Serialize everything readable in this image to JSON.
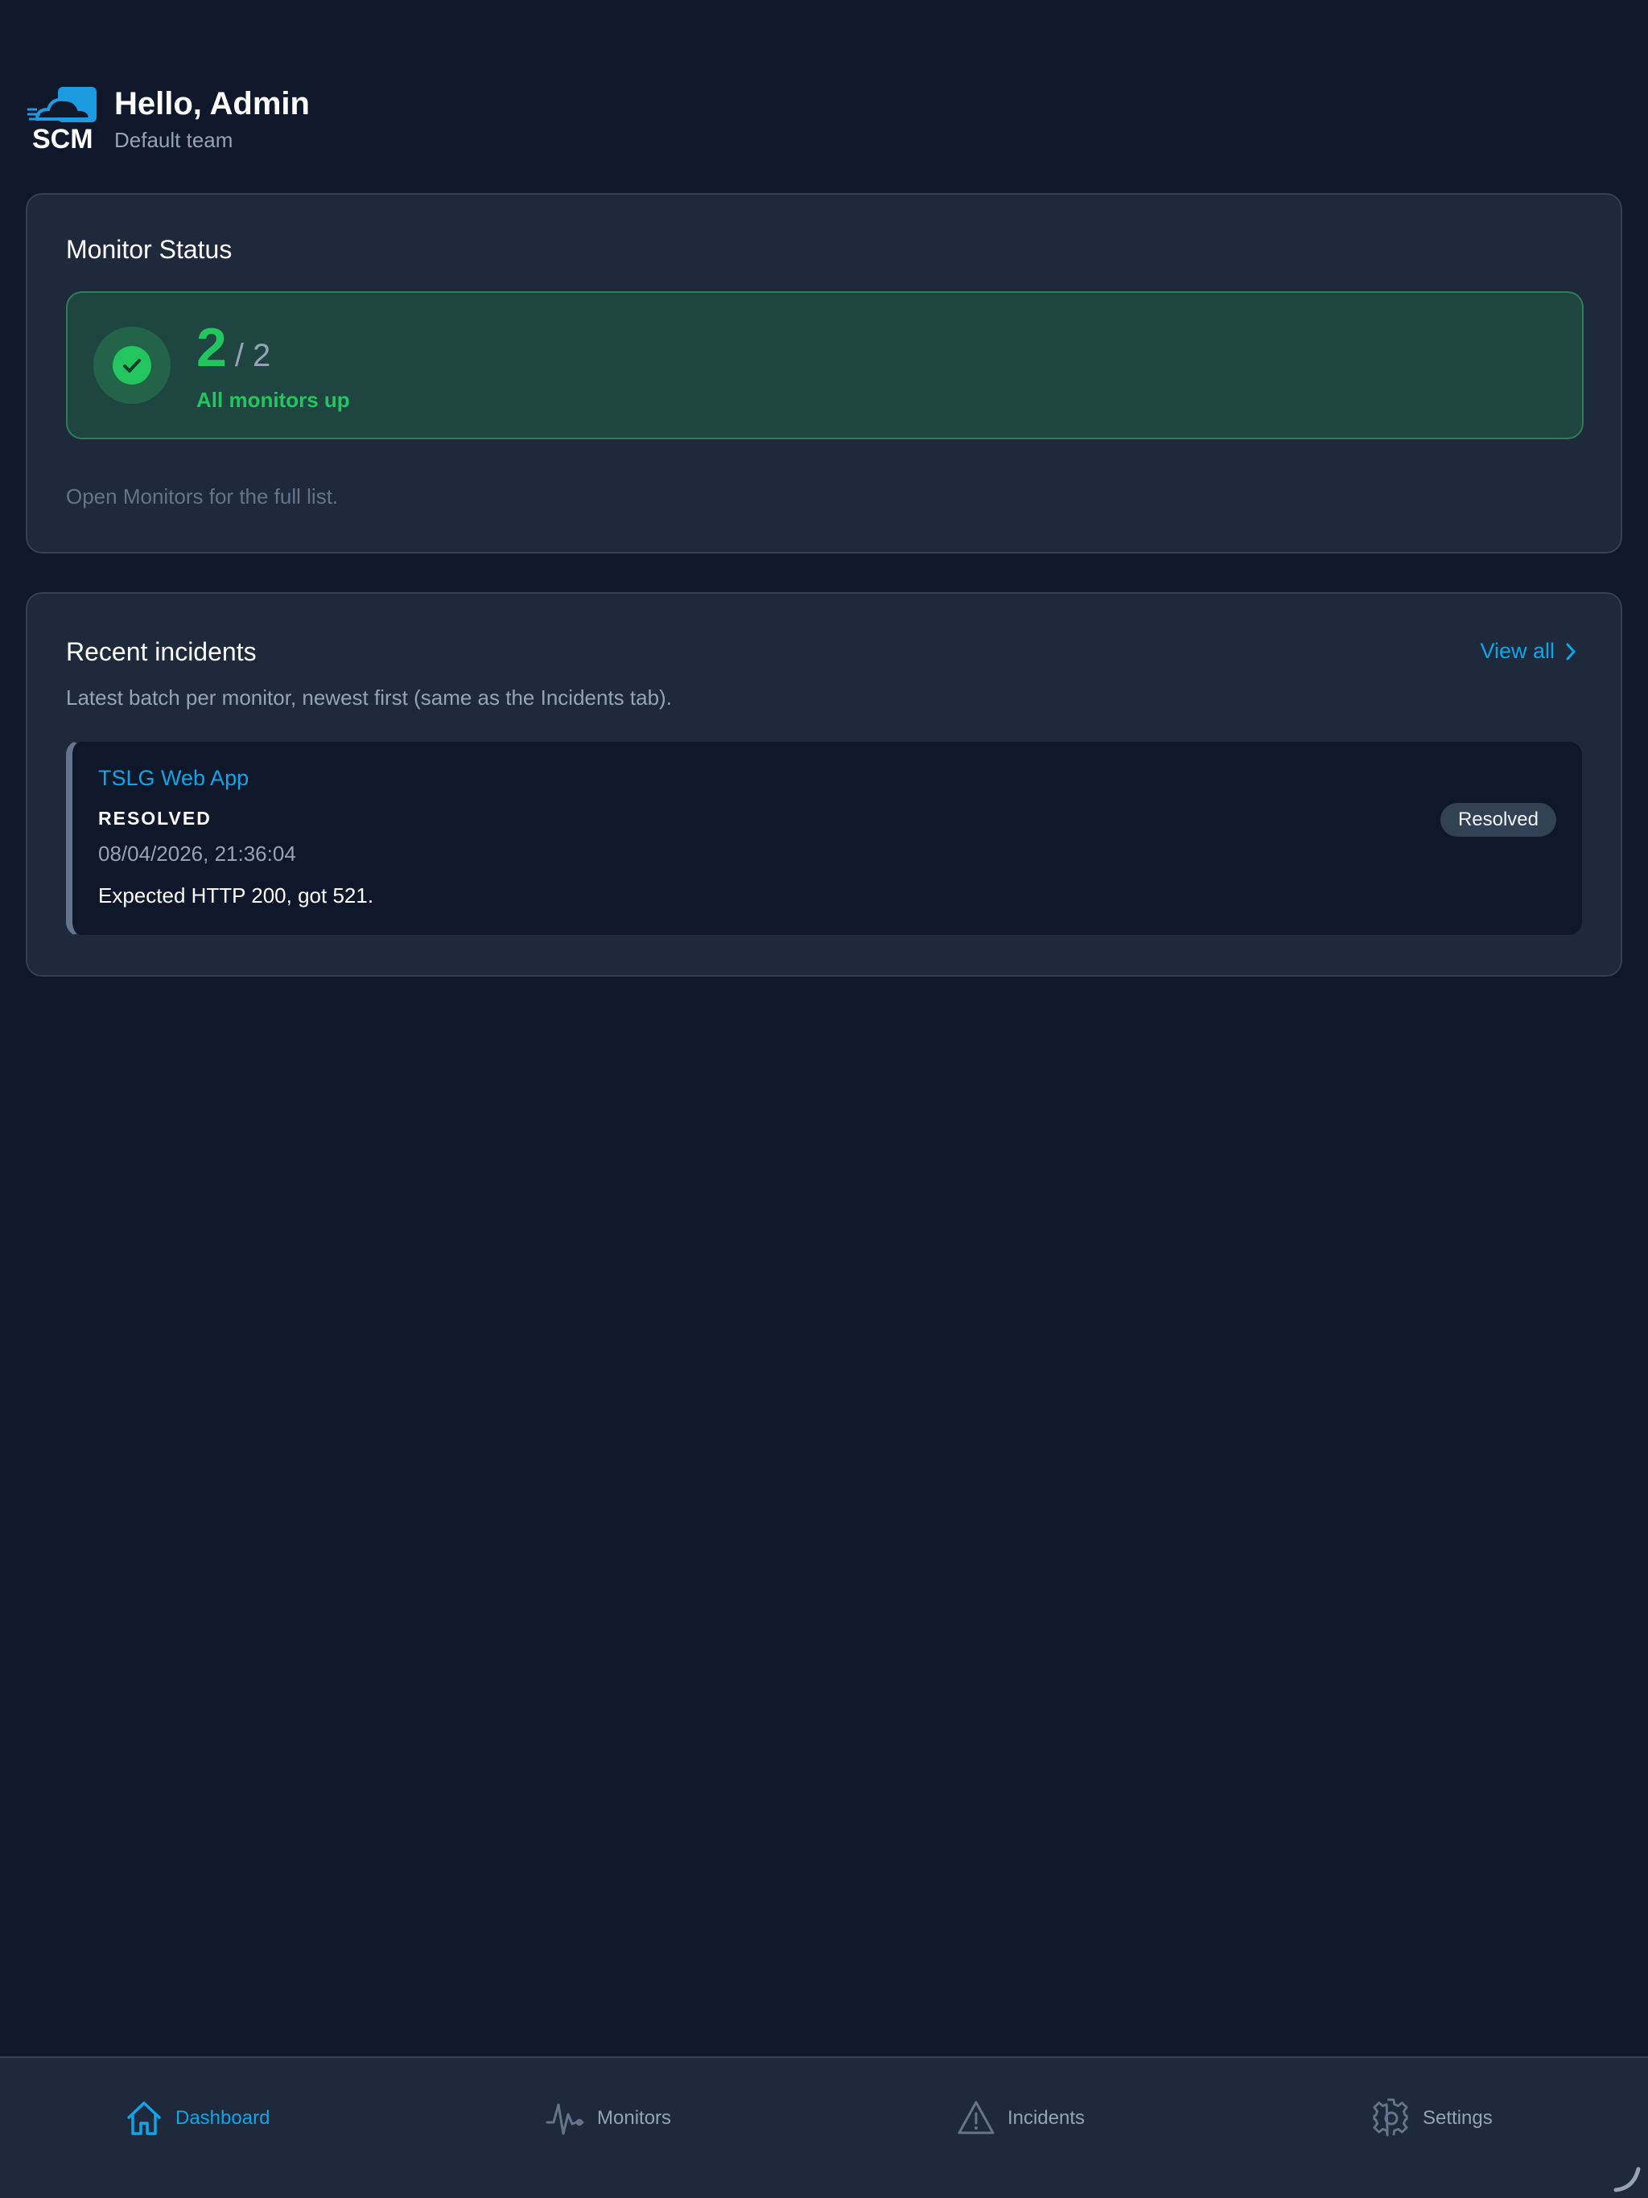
{
  "header": {
    "logo_text": "SCM",
    "greeting": "Hello, Admin",
    "team": "Default team"
  },
  "monitor_status": {
    "title": "Monitor Status",
    "up": "2",
    "total": "/ 2",
    "label": "All monitors up",
    "hint": "Open Monitors for the full list."
  },
  "incidents": {
    "title": "Recent incidents",
    "view_all": "View all",
    "subtitle": "Latest batch per monitor, newest first (same as the Incidents tab).",
    "items": [
      {
        "monitor": "TSLG Web App",
        "state": "RESOLVED",
        "time": "08/04/2026, 21:36:04",
        "message": "Expected HTTP 200, got 521.",
        "badge": "Resolved"
      }
    ]
  },
  "nav": {
    "items": [
      {
        "label": "Dashboard",
        "icon": "home-icon",
        "active": true
      },
      {
        "label": "Monitors",
        "icon": "activity-icon",
        "active": false
      },
      {
        "label": "Incidents",
        "icon": "warning-triangle-icon",
        "active": false
      },
      {
        "label": "Settings",
        "icon": "gear-icon",
        "active": false
      }
    ]
  },
  "colors": {
    "background": "#0f172a",
    "card": "#1e293b",
    "accent": "#0ea5e9",
    "success": "#22c55e"
  }
}
